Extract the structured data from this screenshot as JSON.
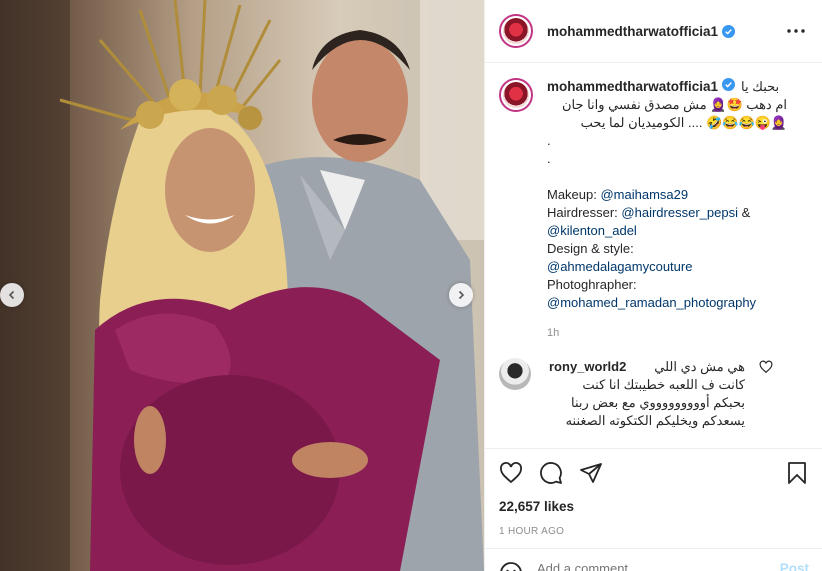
{
  "post": {
    "username": "mohammedtharwatofficia1",
    "verified": true,
    "more_icon": "more-horizontal-icon"
  },
  "caption": {
    "username": "mohammedtharwatofficia1",
    "line1": "بحبك يا",
    "line2": "ام دهب 🤩🧕 مش مصدق نفسي وانا جان",
    "line3": "🧕😜😂😂🤣 .... الكوميديان لما يحب",
    "dot1": ".",
    "dot2": ".",
    "credits": [
      {
        "label": "Makeup: ",
        "handle": "@maihamsa29",
        "suffix": ""
      },
      {
        "label": "Hairdresser: ",
        "handle": "@hairdresser_pepsi",
        "suffix": " &"
      },
      {
        "label": "",
        "handle": "@kilenton_adel",
        "suffix": ""
      },
      {
        "label": "Design & style:",
        "handle": "",
        "suffix": ""
      },
      {
        "label": "",
        "handle": "@ahmedalagamycouture",
        "suffix": ""
      },
      {
        "label": "Photoghrapher:",
        "handle": "",
        "suffix": ""
      },
      {
        "label": "",
        "handle": "@mohamed_ramadan_photography",
        "suffix": ""
      }
    ],
    "time": "1h"
  },
  "comment": {
    "username": "rony_world2",
    "line1": "هي مش دي اللي",
    "line2": "كانت ف اللعبه خطيبتك انا كنت",
    "line3": "بحبكم أوووووووووي مع بعض ربنا",
    "line4": "يسعدكم ويخليكم الكتكوته الصغننه"
  },
  "actions": {
    "icons": [
      "heart-icon",
      "comment-icon",
      "share-icon",
      "bookmark-icon"
    ],
    "likes": "22,657 likes",
    "posted": "1 HOUR AGO"
  },
  "add_comment": {
    "placeholder": "Add a comment...",
    "post_label": "Post"
  },
  "colors": {
    "accent_link": "#00376b",
    "verified": "#3897f0",
    "post_disabled": "#b2dffc",
    "dress": "#8b1f55"
  }
}
